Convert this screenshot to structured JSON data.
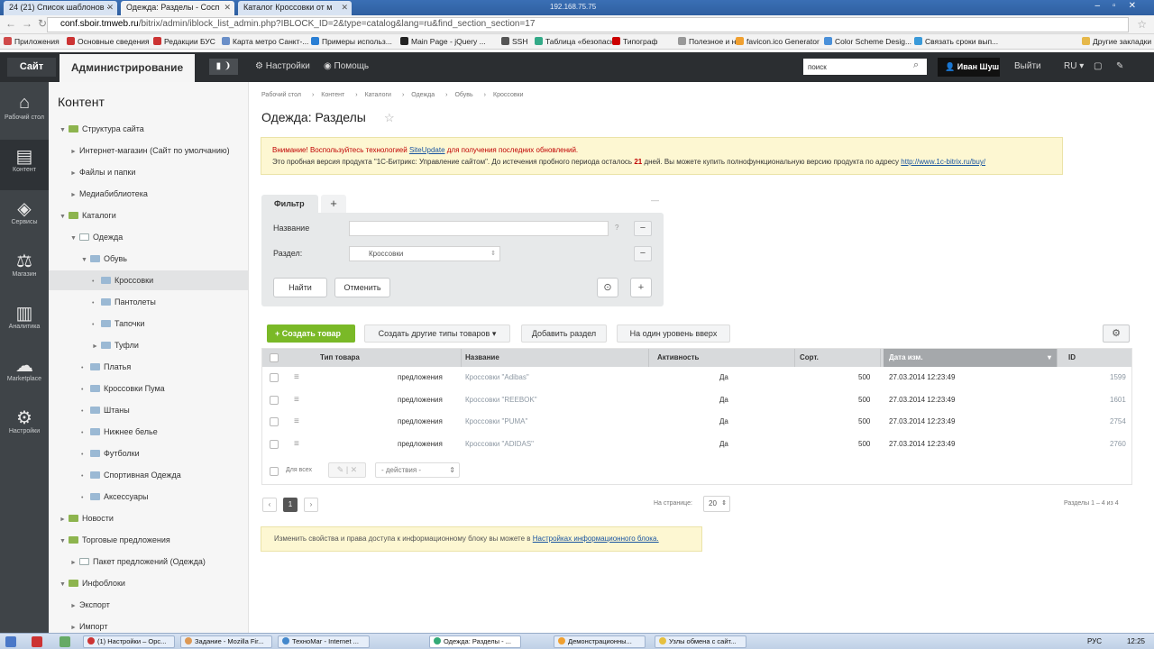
{
  "browser": {
    "tabs": [
      {
        "label": "24 (21) Список шаблонов ·"
      },
      {
        "label": "Одежда: Разделы - Сосп"
      },
      {
        "label": "Каталог Кроссовки от м"
      }
    ],
    "window_title": "192.168.75.75",
    "url_host": "conf.sboir.tmweb.ru",
    "url_path": "/bitrix/admin/iblock_list_admin.php?IBLOCK_ID=2&type=catalog&lang=ru&find_section_section=17",
    "bookmarks": [
      {
        "label": "Приложения",
        "color": "#d04a4a"
      },
      {
        "label": "Основные сведения",
        "color": "#c33"
      },
      {
        "label": "Редакции БУС",
        "color": "#c33"
      },
      {
        "label": "Карта метро Санкт-...",
        "color": "#6a8fc8"
      },
      {
        "label": "Примеры использ...",
        "color": "#2a7fd4"
      },
      {
        "label": "Main Page - jQuery ...",
        "color": "#222"
      },
      {
        "label": "SSH",
        "color": "#555"
      },
      {
        "label": "Таблица «безопасн...",
        "color": "#3a8"
      },
      {
        "label": "Типограф",
        "color": "#c00"
      },
      {
        "label": "Полезное и нет",
        "color": "#999"
      },
      {
        "label": "favicon.ico Generator",
        "color": "#f0a030"
      },
      {
        "label": "Color Scheme Desig...",
        "color": "#4a90d9"
      },
      {
        "label": "Связать сроки вып...",
        "color": "#3a9ad9"
      },
      {
        "label": "Другие закладки",
        "color": "#e6b84a"
      }
    ]
  },
  "header": {
    "site_label": "Сайт",
    "admin_label": "Администрирование",
    "badge": "▮ ❩",
    "settings_label": "Настройки",
    "help_label": "Помощь",
    "search_value": "поиск",
    "user_label": "Иван Шуш",
    "logout_label": "Выйти",
    "lang_label": "RU"
  },
  "iconbar": [
    {
      "label": "Рабочий стол",
      "icon": "⌂"
    },
    {
      "label": "Контент",
      "icon": "▤"
    },
    {
      "label": "Сервисы",
      "icon": "◈"
    },
    {
      "label": "Магазин",
      "icon": "⚖"
    },
    {
      "label": "Аналитика",
      "icon": "▥"
    },
    {
      "label": "Marketplace",
      "icon": "☁"
    },
    {
      "label": "Настройки",
      "icon": "⚙"
    }
  ],
  "tree": {
    "title": "Контент",
    "items": [
      {
        "label": "Структура сайта",
        "arrow": "▼",
        "icon": "green"
      },
      {
        "label": "Интернет-магазин (Сайт по умолчанию)",
        "arrow": "►",
        "icon": ""
      },
      {
        "label": "Файлы и папки",
        "arrow": "►",
        "icon": ""
      },
      {
        "label": "Медиабиблиотека",
        "arrow": "►",
        "icon": ""
      },
      {
        "label": "Каталоги",
        "arrow": "▼",
        "icon": "green"
      },
      {
        "label": "Одежда",
        "arrow": "▼",
        "icon": "page"
      },
      {
        "label": "Обувь",
        "arrow": "▼",
        "icon": "blue"
      },
      {
        "label": "Кроссовки",
        "arrow": "•",
        "icon": "blue"
      },
      {
        "label": "Пантолеты",
        "arrow": "•",
        "icon": "blue"
      },
      {
        "label": "Тапочки",
        "arrow": "•",
        "icon": "blue"
      },
      {
        "label": "Туфли",
        "arrow": "►",
        "icon": "blue"
      },
      {
        "label": "Платья",
        "arrow": "•",
        "icon": "blue"
      },
      {
        "label": "Кроссовки Пума",
        "arrow": "•",
        "icon": "blue"
      },
      {
        "label": "Штаны",
        "arrow": "•",
        "icon": "blue"
      },
      {
        "label": "Нижнее белье",
        "arrow": "•",
        "icon": "blue"
      },
      {
        "label": "Футболки",
        "arrow": "•",
        "icon": "blue"
      },
      {
        "label": "Спортивная Одежда",
        "arrow": "•",
        "icon": "blue"
      },
      {
        "label": "Аксессуары",
        "arrow": "•",
        "icon": "blue"
      },
      {
        "label": "Новости",
        "arrow": "►",
        "icon": "green"
      },
      {
        "label": "Торговые предложения",
        "arrow": "▼",
        "icon": "green"
      },
      {
        "label": "Пакет предложений (Одежда)",
        "arrow": "►",
        "icon": "page"
      },
      {
        "label": "Инфоблоки",
        "arrow": "▼",
        "icon": "green"
      },
      {
        "label": "Экспорт",
        "arrow": "►",
        "icon": ""
      },
      {
        "label": "Импорт",
        "arrow": "►",
        "icon": ""
      }
    ]
  },
  "main": {
    "breadcrumb": [
      "Рабочий стол",
      "Контент",
      "Каталоги",
      "Одежда",
      "Обувь",
      "Кроссовки"
    ],
    "title": "Одежда: Разделы",
    "notice": {
      "warn_prefix": "Внимание! Воспользуйтесь технологией",
      "warn_link": "SiteUpdate",
      "warn_suffix": "для получения последних обновлений.",
      "trial_text": "Это пробная версия продукта \"1С-Битрикс: Управление сайтом\". До истечения пробного периода осталось",
      "trial_days": "21",
      "trial_text2": "дней. Вы можете купить полнофункциональную версию продукта по адресу",
      "trial_link": "http://www.1c-bitrix.ru/buy/"
    },
    "filter": {
      "tab_label": "Фильтр",
      "name_label": "Название",
      "section_label": "Раздел:",
      "section_value": "Кроссовки",
      "find_label": "Найти",
      "cancel_label": "Отменить"
    },
    "toolbar": {
      "create_label": "Создать товар",
      "other_types_label": "Создать другие типы товаров",
      "add_section_label": "Добавить раздел",
      "level_up_label": "На один уровень вверх"
    },
    "table": {
      "headers": [
        "Тип товара",
        "Название",
        "Активность",
        "Сорт.",
        "Дата изм.",
        "ID"
      ],
      "rows": [
        {
          "type": "предложения",
          "name": "Кроссовки \"Adibas\"",
          "active": "Да",
          "sort": "500",
          "date": "27.03.2014 12:23:49",
          "id": "1599"
        },
        {
          "type": "предложения",
          "name": "Кроссовки \"REEBOK\"",
          "active": "Да",
          "sort": "500",
          "date": "27.03.2014 12:23:49",
          "id": "1601"
        },
        {
          "type": "предложения",
          "name": "Кроссовки \"PUMA\"",
          "active": "Да",
          "sort": "500",
          "date": "27.03.2014 12:23:49",
          "id": "2754"
        },
        {
          "type": "предложения",
          "name": "Кроссовки \"ADIDAS\"",
          "active": "Да",
          "sort": "500",
          "date": "27.03.2014 12:23:49",
          "id": "2760"
        }
      ],
      "footer_all_label": "Для всех",
      "actions_label": "- действия -"
    },
    "pagination": {
      "current": "1",
      "per_page_label": "На странице:",
      "per_page_value": "20",
      "summary": "Разделы 1 – 4 из 4"
    },
    "notice2": {
      "text": "Изменить свойства и права доступа к информационному блоку вы можете в",
      "link": "Настройках информационного блока."
    }
  },
  "taskbar": {
    "items": [
      {
        "label": "(1) Настройки – Орс..."
      },
      {
        "label": "Задание - Mozilla Fir..."
      },
      {
        "label": "ТехноМаг - Internet ..."
      },
      {
        "label": "Одежда: Разделы - ..."
      },
      {
        "label": "Демонстрационны..."
      },
      {
        "label": "Узлы обмена с сайт..."
      }
    ],
    "lang": "РУС",
    "time": "12:25"
  }
}
